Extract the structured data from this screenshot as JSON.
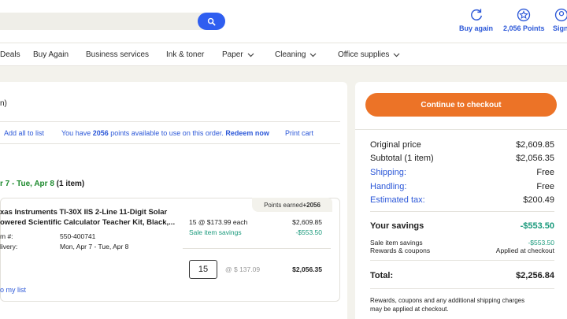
{
  "header": {
    "buy_again": "Buy again",
    "points": "2,056 Points",
    "sign_in": "Sign"
  },
  "nav": {
    "items": [
      {
        "label": "Deals",
        "chevron": false
      },
      {
        "label": "Buy Again",
        "chevron": false
      },
      {
        "label": "Business services",
        "chevron": false
      },
      {
        "label": "Ink & toner",
        "chevron": false
      },
      {
        "label": "Paper",
        "chevron": true
      },
      {
        "label": "Cleaning",
        "chevron": true
      },
      {
        "label": "Office supplies",
        "chevron": true
      }
    ]
  },
  "cart": {
    "heading_fragment": "n)",
    "add_all": "Add all to list",
    "points_msg_prefix": "You have ",
    "points_count": "2056",
    "points_msg_suffix": " points available to use on this order. ",
    "redeem": "Redeem now",
    "print": "Print cart",
    "delivery_range": "r 7 - Tue, Apr 8",
    "delivery_count": " (1 item)",
    "item": {
      "points_label": "Points earned ",
      "points_value": "+2056",
      "title_line1": "xas Instruments TI-30X IIS 2-Line 11-Digit Solar",
      "title_line2": "owered Scientific Calculator Teacher Kit, Black,...",
      "item_label": "m #:",
      "item_value": "550-400741",
      "delivery_label": "livery:",
      "delivery_value": "Mon, Apr 7 - Tue, Apr 8",
      "qty_price": "15 @ $173.99 each",
      "sale_label": "Sale item savings",
      "orig_total": "$2,609.85",
      "sale_amount": "-$553.50",
      "qty": "15",
      "unit_price": "@ $ 137.09",
      "line_total": "$2,056.35",
      "move_to_list": "o my list"
    }
  },
  "summary": {
    "checkout": "Continue to checkout",
    "original_label": "Original price",
    "original_value": "$2,609.85",
    "subtotal_label": "Subtotal (1 item)",
    "subtotal_value": "$2,056.35",
    "shipping_label": "Shipping:",
    "shipping_value": "Free",
    "handling_label": "Handling:",
    "handling_value": "Free",
    "tax_label": "Estimated tax:",
    "tax_value": "$200.49",
    "savings_label": "Your savings",
    "savings_value": "-$553.50",
    "sale_label": "Sale item savings",
    "sale_value": "-$553.50",
    "rewards_label": "Rewards & coupons",
    "rewards_value": "Applied at checkout",
    "total_label": "Total:",
    "total_value": "$2,256.84",
    "note_line1": "Rewards, coupons and any additional shipping charges",
    "note_line2": "may be applied at checkout."
  },
  "colors": {
    "brand_blue": "#2f5ef0",
    "link_blue": "#2c58d8",
    "checkout_orange": "#ec7327",
    "savings_green": "#1a9a7c",
    "delivery_green": "#1e8a2e"
  }
}
